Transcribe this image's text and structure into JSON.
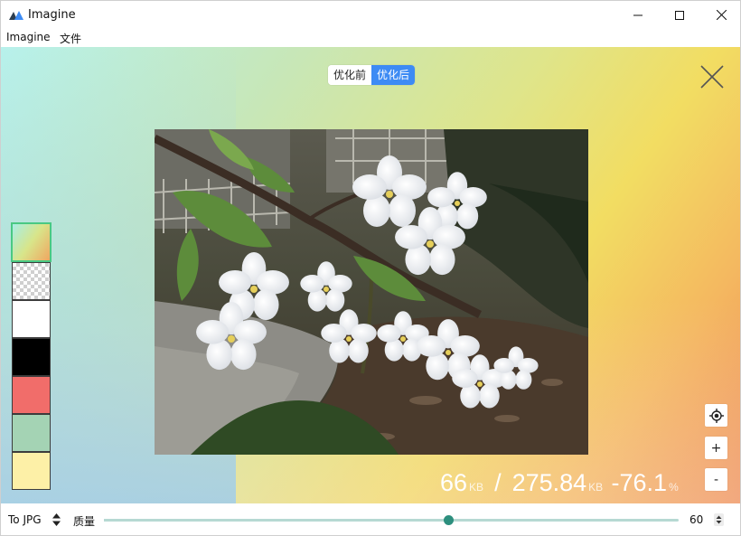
{
  "window": {
    "title": "Imagine",
    "controls": {
      "minimize": "minimize",
      "maximize": "maximize",
      "close": "close"
    }
  },
  "menu": {
    "items": [
      {
        "label": "Imagine"
      },
      {
        "label": "文件"
      }
    ]
  },
  "viewer": {
    "toggle": {
      "before_label": "优化前",
      "after_label": "优化后",
      "active": "after"
    },
    "accent_color": "#3d8bf4",
    "backgrounds": [
      {
        "name": "gradient",
        "selected": true
      },
      {
        "name": "transparent-checker",
        "selected": false
      },
      {
        "name": "white",
        "color": "#ffffff",
        "selected": false
      },
      {
        "name": "black",
        "color": "#000000",
        "selected": false
      },
      {
        "name": "red",
        "color": "#f16d6a",
        "selected": false
      },
      {
        "name": "green",
        "color": "#a4d3b4",
        "selected": false
      },
      {
        "name": "yellow",
        "color": "#fdf0a7",
        "selected": false
      }
    ],
    "zoom": {
      "locate_icon": "locate-icon",
      "plus_label": "+",
      "minus_label": "-"
    },
    "stats": {
      "optimized_size": "66",
      "optimized_unit": "KB",
      "separator": "/",
      "original_size": "275.84",
      "original_unit": "KB",
      "change": "-76.1",
      "change_unit": "%"
    }
  },
  "bottom": {
    "format_label": "To JPG",
    "quality_label": "质量",
    "quality_value": "60",
    "quality_fraction": 0.6,
    "slider_color": "#2d8f7e"
  }
}
